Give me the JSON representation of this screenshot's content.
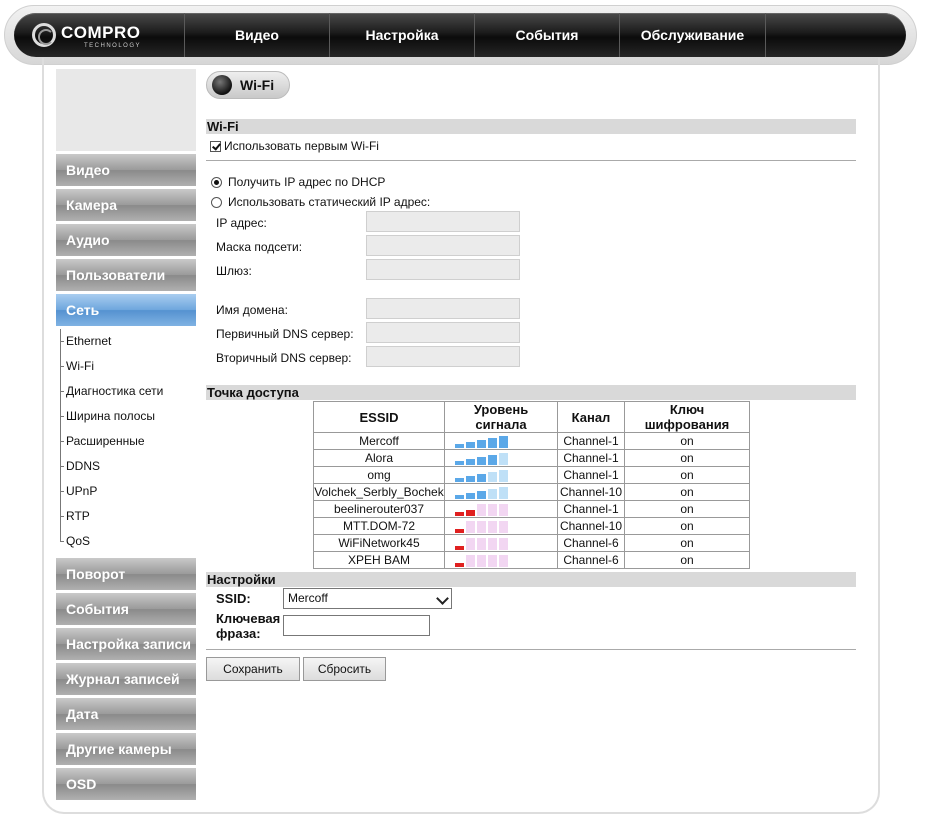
{
  "brand": {
    "name": "COMPRO",
    "sub": "TECHNOLOGY"
  },
  "topnav": [
    {
      "label": "Видео"
    },
    {
      "label": "Настройка"
    },
    {
      "label": "События"
    },
    {
      "label": "Обслуживание"
    }
  ],
  "sidebar": {
    "items_before": [
      {
        "label": "Видео"
      },
      {
        "label": "Камера"
      },
      {
        "label": "Аудио"
      },
      {
        "label": "Пользователи"
      }
    ],
    "active": {
      "label": "Сеть"
    },
    "sub_items": [
      {
        "label": "Ethernet"
      },
      {
        "label": "Wi-Fi"
      },
      {
        "label": "Диагностика сети"
      },
      {
        "label": "Ширина полосы"
      },
      {
        "label": "Расширенные"
      },
      {
        "label": "DDNS"
      },
      {
        "label": "UPnP"
      },
      {
        "label": "RTP"
      },
      {
        "label": "QoS"
      }
    ],
    "items_after": [
      {
        "label": "Поворот"
      },
      {
        "label": "События"
      },
      {
        "label": "Настройка записи"
      },
      {
        "label": "Журнал записей"
      },
      {
        "label": "Дата"
      },
      {
        "label": "Другие камеры"
      },
      {
        "label": "OSD"
      }
    ]
  },
  "page_title": "Wi-Fi",
  "wifi": {
    "section_title": "Wi-Fi",
    "use_first_label": "Использовать первым Wi-Fi",
    "use_first_checked": true,
    "dhcp_label": "Получить IP адрес по DHCP",
    "static_label": "Использовать статический IP адрес:",
    "dhcp_selected": true,
    "ip_label": "IP адрес:",
    "mask_label": "Маска подсети:",
    "gateway_label": "Шлюз:",
    "domain_label": "Имя домена:",
    "dns1_label": "Первичный DNS сервер:",
    "dns2_label": "Вторичный DNS сервер:"
  },
  "access_point": {
    "section_title": "Точка доступа",
    "headers": {
      "essid": "ESSID",
      "signal": "Уровень сигнала",
      "channel": "Канал",
      "key": "Ключ шифрования"
    },
    "colors": {
      "strong": "#5ba8e8",
      "strong_dim": "#bfe0f7",
      "weak": "#e02020",
      "weak_dim": "#f2d6f2"
    },
    "rows": [
      {
        "essid": "Mercoff",
        "signal": 5,
        "quality": "strong",
        "channel": "Channel-1",
        "key": "on"
      },
      {
        "essid": "Alora",
        "signal": 4,
        "quality": "strong",
        "channel": "Channel-1",
        "key": "on"
      },
      {
        "essid": "omg",
        "signal": 3,
        "quality": "strong",
        "channel": "Channel-1",
        "key": "on"
      },
      {
        "essid": "Volchek_Serbly_Bochek",
        "signal": 3,
        "quality": "strong",
        "channel": "Channel-10",
        "key": "on"
      },
      {
        "essid": "beelinerouter037",
        "signal": 2,
        "quality": "weak",
        "channel": "Channel-1",
        "key": "on"
      },
      {
        "essid": "MTT.DOM-72",
        "signal": 1,
        "quality": "weak",
        "channel": "Channel-10",
        "key": "on"
      },
      {
        "essid": "WiFiNetwork45",
        "signal": 1,
        "quality": "weak",
        "channel": "Channel-6",
        "key": "on"
      },
      {
        "essid": "XPEH BAM",
        "signal": 1,
        "quality": "weak",
        "channel": "Channel-6",
        "key": "on"
      }
    ]
  },
  "settings": {
    "section_title": "Настройки",
    "ssid_label": "SSID:",
    "ssid_value": "Mercoff",
    "pass_label_1": "Ключевая",
    "pass_label_2": "фраза:",
    "pass_value": ""
  },
  "buttons": {
    "save": "Сохранить",
    "reset": "Сбросить"
  }
}
